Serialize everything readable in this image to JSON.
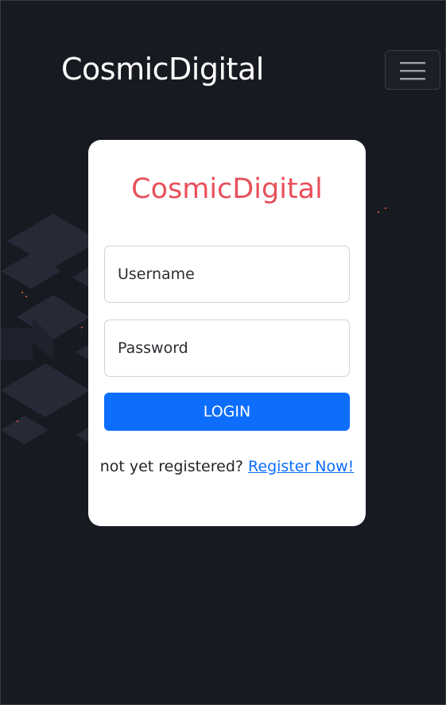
{
  "navbar": {
    "brand": "CosmicDigital",
    "toggler_icon": "hamburger-menu-icon"
  },
  "login_card": {
    "title": "CosmicDigital",
    "username": {
      "placeholder": "Username",
      "value": ""
    },
    "password": {
      "placeholder": "Password",
      "value": ""
    },
    "login_label": "LOGIN",
    "register_prompt": "not yet registered?",
    "register_link": "Register Now!"
  },
  "colors": {
    "background": "#181a22",
    "title": "#e8505b",
    "primary": "#0d6efd",
    "card": "#ffffff"
  }
}
